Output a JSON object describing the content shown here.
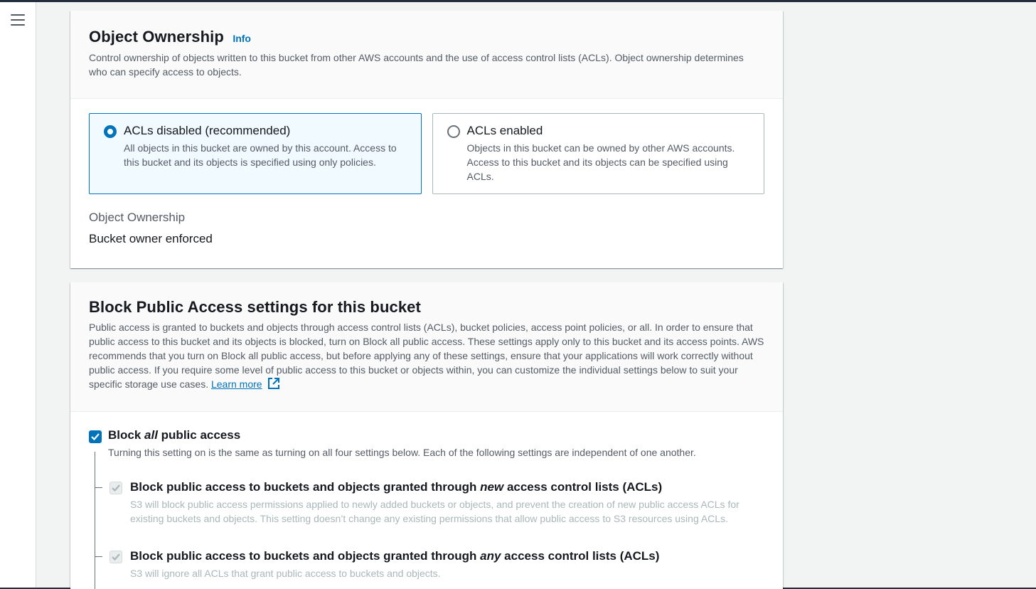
{
  "nav": {
    "menu_icon": "hamburger-menu-icon"
  },
  "ownership": {
    "title": "Object Ownership",
    "info": "Info",
    "description": "Control ownership of objects written to this bucket from other AWS accounts and the use of access control lists (ACLs). Object ownership determines who can specify access to objects.",
    "options": [
      {
        "label": "ACLs disabled (recommended)",
        "description": "All objects in this bucket are owned by this account. Access to this bucket and its objects is specified using only policies.",
        "selected": true
      },
      {
        "label": "ACLs enabled",
        "description": "Objects in this bucket can be owned by other AWS accounts. Access to this bucket and its objects can be specified using ACLs.",
        "selected": false
      }
    ],
    "field_label": "Object Ownership",
    "field_value": "Bucket owner enforced"
  },
  "bpa": {
    "title": "Block Public Access settings for this bucket",
    "description": "Public access is granted to buckets and objects through access control lists (ACLs), bucket policies, access point policies, or all. In order to ensure that public access to this bucket and its objects is blocked, turn on Block all public access. These settings apply only to this bucket and its access points. AWS recommends that you turn on Block all public access, but before applying any of these settings, ensure that your applications will work correctly without public access. If you require some level of public access to this bucket or objects within, you can customize the individual settings below to suit your specific storage use cases.",
    "learn_more": "Learn more",
    "master": {
      "label_pre": "Block ",
      "label_em": "all",
      "label_post": " public access",
      "description": "Turning this setting on is the same as turning on all four settings below. Each of the following settings are independent of one another.",
      "checked": true
    },
    "settings": [
      {
        "label_pre": "Block public access to buckets and objects granted through ",
        "label_em": "new",
        "label_post": " access control lists (ACLs)",
        "description": "S3 will block public access permissions applied to newly added buckets or objects, and prevent the creation of new public access ACLs for existing buckets and objects. This setting doesn’t change any existing permissions that allow public access to S3 resources using ACLs.",
        "checked": true
      },
      {
        "label_pre": "Block public access to buckets and objects granted through ",
        "label_em": "any",
        "label_post": " access control lists (ACLs)",
        "description": "S3 will ignore all ACLs that grant public access to buckets and objects.",
        "checked": true
      }
    ]
  },
  "colors": {
    "accent": "#0073bb",
    "selected_bg": "#f1faff",
    "disabled": "#aab7b8"
  }
}
